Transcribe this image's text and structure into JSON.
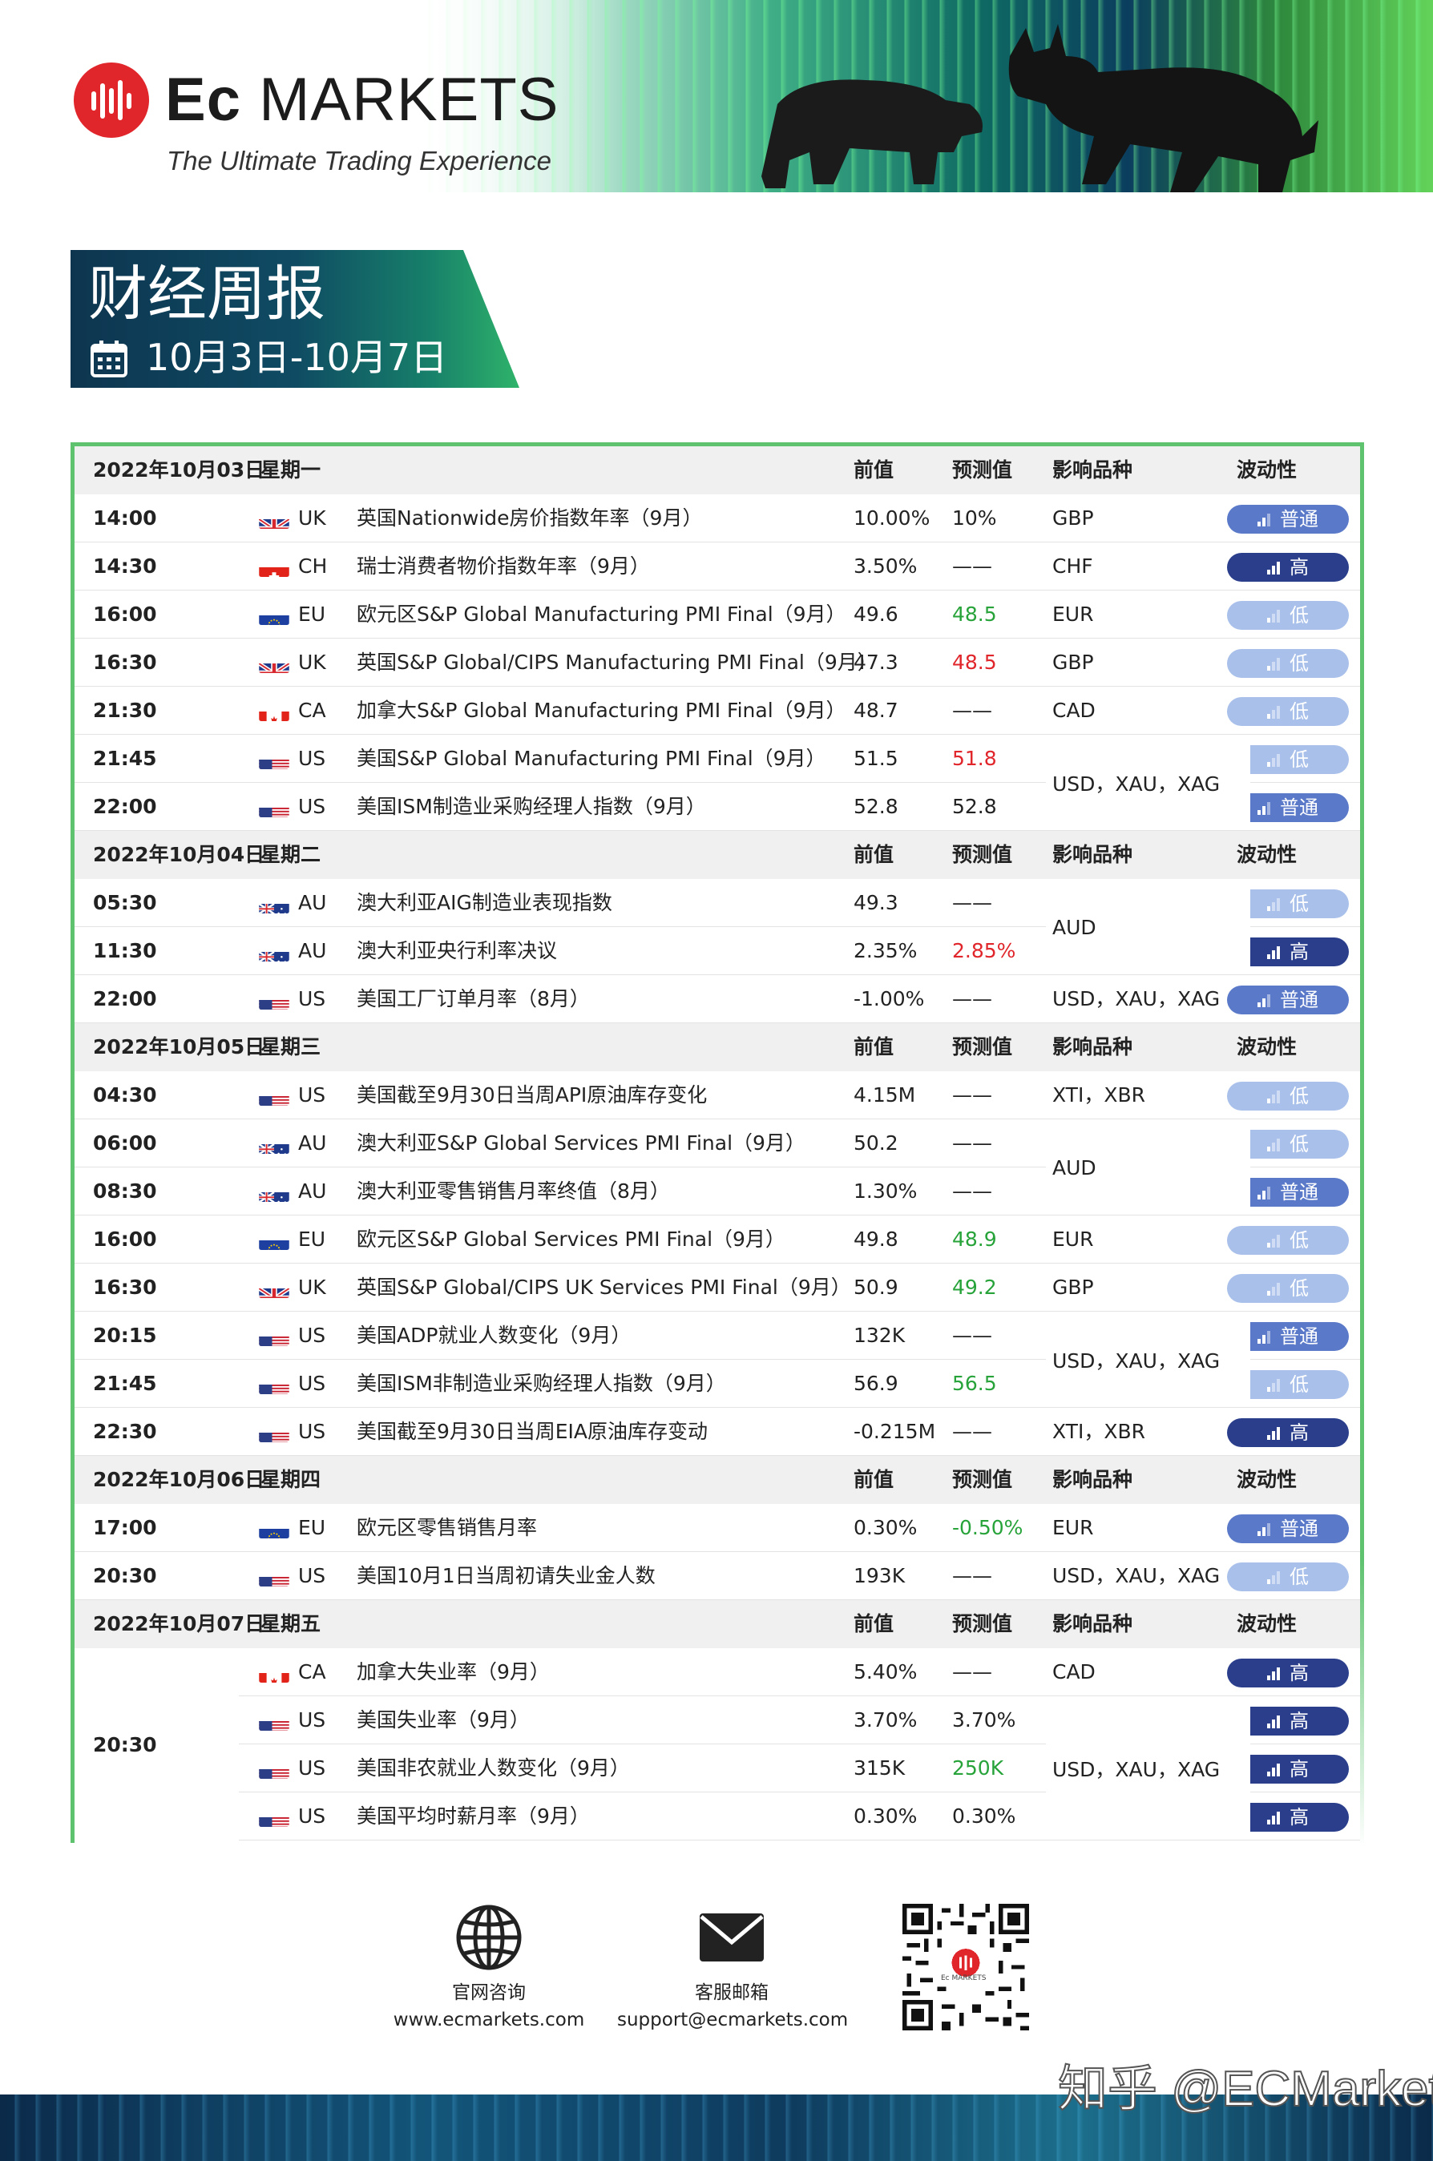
{
  "brand": {
    "name_bold": "Ec",
    "name_rest": " MARKETS",
    "tagline": "The Ultimate Trading Experience"
  },
  "banner": {
    "title": "财经周报",
    "date_range": "10月3日-10月7日"
  },
  "columns": {
    "prev": "前值",
    "forecast": "预测值",
    "symbols": "影响品种",
    "volatility": "波动性"
  },
  "days": [
    {
      "date": "2022年10月03日",
      "weekday": "星期一",
      "events": [
        {
          "time": "14:00",
          "flag": "uk",
          "cc": "UK",
          "event": "英国Nationwide房价指数年率（9月）",
          "prev": "10.00%",
          "forecast": "10%",
          "fc_color": "normal",
          "symbols": "GBP",
          "vol": "普通",
          "level": "mid"
        },
        {
          "time": "14:30",
          "flag": "ch",
          "cc": "CH",
          "event": "瑞士消费者物价指数年率（9月）",
          "prev": "3.50%",
          "forecast": "——",
          "fc_color": "normal",
          "symbols": "CHF",
          "vol": "高",
          "level": "high"
        },
        {
          "time": "16:00",
          "flag": "eu",
          "cc": "EU",
          "event": "欧元区S&P Global Manufacturing PMI Final（9月）",
          "prev": "49.6",
          "forecast": "48.5",
          "fc_color": "green",
          "symbols": "EUR",
          "vol": "低",
          "level": "low"
        },
        {
          "time": "16:30",
          "flag": "uk",
          "cc": "UK",
          "event": "英国S&P Global/CIPS Manufacturing PMI Final（9月）",
          "prev": "47.3",
          "forecast": "48.5",
          "fc_color": "red",
          "symbols": "GBP",
          "vol": "低",
          "level": "low"
        },
        {
          "time": "21:30",
          "flag": "ca",
          "cc": "CA",
          "event": "加拿大S&P Global Manufacturing PMI Final（9月）",
          "prev": "48.7",
          "forecast": "——",
          "fc_color": "normal",
          "symbols": "CAD",
          "vol": "低",
          "level": "low"
        },
        {
          "time": "21:45",
          "flag": "us",
          "cc": "US",
          "event": "美国S&P Global Manufacturing PMI Final（9月）",
          "prev": "51.5",
          "forecast": "51.8",
          "fc_color": "red",
          "symbols": "",
          "vol": "低",
          "level": "low"
        },
        {
          "time": "22:00",
          "flag": "us",
          "cc": "US",
          "event": "美国ISM制造业采购经理人指数（9月）",
          "prev": "52.8",
          "forecast": "52.8",
          "fc_color": "normal",
          "symbols": "",
          "vol": "普通",
          "level": "mid"
        }
      ],
      "merged_symbols": [
        "USD，XAU，XAG"
      ]
    },
    {
      "date": "2022年10月04日",
      "weekday": "星期二",
      "events": [
        {
          "time": "05:30",
          "flag": "au",
          "cc": "AU",
          "event": "澳大利亚AIG制造业表现指数",
          "prev": "49.3",
          "forecast": "——",
          "fc_color": "normal",
          "symbols": "",
          "vol": "低",
          "level": "low"
        },
        {
          "time": "11:30",
          "flag": "au",
          "cc": "AU",
          "event": "澳大利亚央行利率决议",
          "prev": "2.35%",
          "forecast": "2.85%",
          "fc_color": "red",
          "symbols": "",
          "vol": "高",
          "level": "high"
        },
        {
          "time": "22:00",
          "flag": "us",
          "cc": "US",
          "event": "美国工厂订单月率（8月）",
          "prev": "-1.00%",
          "forecast": "——",
          "fc_color": "normal",
          "symbols": "USD，XAU，XAG",
          "vol": "普通",
          "level": "mid"
        }
      ],
      "merged_symbols": [
        "AUD"
      ]
    },
    {
      "date": "2022年10月05日",
      "weekday": "星期三",
      "events": [
        {
          "time": "04:30",
          "flag": "us",
          "cc": "US",
          "event": "美国截至9月30日当周API原油库存变化",
          "prev": "4.15M",
          "forecast": "——",
          "fc_color": "normal",
          "symbols": "XTI，XBR",
          "vol": "低",
          "level": "low"
        },
        {
          "time": "06:00",
          "flag": "au",
          "cc": "AU",
          "event": "澳大利亚S&P Global Services PMI Final（9月）",
          "prev": "50.2",
          "forecast": "——",
          "fc_color": "normal",
          "symbols": "",
          "vol": "低",
          "level": "low"
        },
        {
          "time": "08:30",
          "flag": "au",
          "cc": "AU",
          "event": "澳大利亚零售销售月率终值（8月）",
          "prev": "1.30%",
          "forecast": "——",
          "fc_color": "normal",
          "symbols": "",
          "vol": "普通",
          "level": "mid"
        },
        {
          "time": "16:00",
          "flag": "eu",
          "cc": "EU",
          "event": "欧元区S&P Global Services PMI Final（9月）",
          "prev": "49.8",
          "forecast": "48.9",
          "fc_color": "green",
          "symbols": "EUR",
          "vol": "低",
          "level": "low"
        },
        {
          "time": "16:30",
          "flag": "uk",
          "cc": "UK",
          "event": "英国S&P Global/CIPS UK Services PMI Final（9月）",
          "prev": "50.9",
          "forecast": "49.2",
          "fc_color": "green",
          "symbols": "GBP",
          "vol": "低",
          "level": "low"
        },
        {
          "time": "20:15",
          "flag": "us",
          "cc": "US",
          "event": "美国ADP就业人数变化（9月）",
          "prev": "132K",
          "forecast": "——",
          "fc_color": "normal",
          "symbols": "",
          "vol": "普通",
          "level": "mid"
        },
        {
          "time": "21:45",
          "flag": "us",
          "cc": "US",
          "event": "美国ISM非制造业采购经理人指数（9月）",
          "prev": "56.9",
          "forecast": "56.5",
          "fc_color": "green",
          "symbols": "",
          "vol": "低",
          "level": "low"
        },
        {
          "time": "22:30",
          "flag": "us",
          "cc": "US",
          "event": "美国截至9月30日当周EIA原油库存变动",
          "prev": "-0.215M",
          "forecast": "——",
          "fc_color": "normal",
          "symbols": "XTI，XBR",
          "vol": "高",
          "level": "high"
        }
      ],
      "merged_symbols": [
        "AUD",
        "USD，XAU，XAG"
      ]
    },
    {
      "date": "2022年10月06日",
      "weekday": "星期四",
      "events": [
        {
          "time": "17:00",
          "flag": "eu",
          "cc": "EU",
          "event": "欧元区零售销售月率",
          "prev": "0.30%",
          "forecast": "-0.50%",
          "fc_color": "green",
          "symbols": "EUR",
          "vol": "普通",
          "level": "mid"
        },
        {
          "time": "20:30",
          "flag": "us",
          "cc": "US",
          "event": "美国10月1日当周初请失业金人数",
          "prev": "193K",
          "forecast": "——",
          "fc_color": "normal",
          "symbols": "USD，XAU，XAG",
          "vol": "低",
          "level": "low"
        }
      ]
    },
    {
      "date": "2022年10月07日",
      "weekday": "星期五",
      "merged_time": "20:30",
      "events": [
        {
          "time": "",
          "flag": "ca",
          "cc": "CA",
          "event": "加拿大失业率（9月）",
          "prev": "5.40%",
          "forecast": "——",
          "fc_color": "normal",
          "symbols": "CAD",
          "vol": "高",
          "level": "high"
        },
        {
          "time": "",
          "flag": "us",
          "cc": "US",
          "event": "美国失业率（9月）",
          "prev": "3.70%",
          "forecast": "3.70%",
          "fc_color": "normal",
          "symbols": "",
          "vol": "高",
          "level": "high"
        },
        {
          "time": "",
          "flag": "us",
          "cc": "US",
          "event": "美国非农就业人数变化（9月）",
          "prev": "315K",
          "forecast": "250K",
          "fc_color": "green",
          "symbols": "",
          "vol": "高",
          "level": "high"
        },
        {
          "time": "",
          "flag": "us",
          "cc": "US",
          "event": "美国平均时薪月率（9月）",
          "prev": "0.30%",
          "forecast": "0.30%",
          "fc_color": "normal",
          "symbols": "",
          "vol": "高",
          "level": "high"
        }
      ],
      "merged_symbols": [
        "USD，XAU，XAG"
      ]
    }
  ],
  "footer": {
    "website_label": "官网咨询",
    "website_url": "www.ecmarkets.com",
    "email_label": "客服邮箱",
    "email": "support@ecmarkets.com",
    "qr_caption": "Ec MARKETS",
    "watermark": "知乎 @ECMarkets"
  },
  "colors": {
    "high": "#2a3e8c",
    "mid": "#5a79c9",
    "low": "#a9c0ea",
    "green": "#27a33a",
    "red": "#e0262b",
    "frame": "#5ec26f"
  }
}
